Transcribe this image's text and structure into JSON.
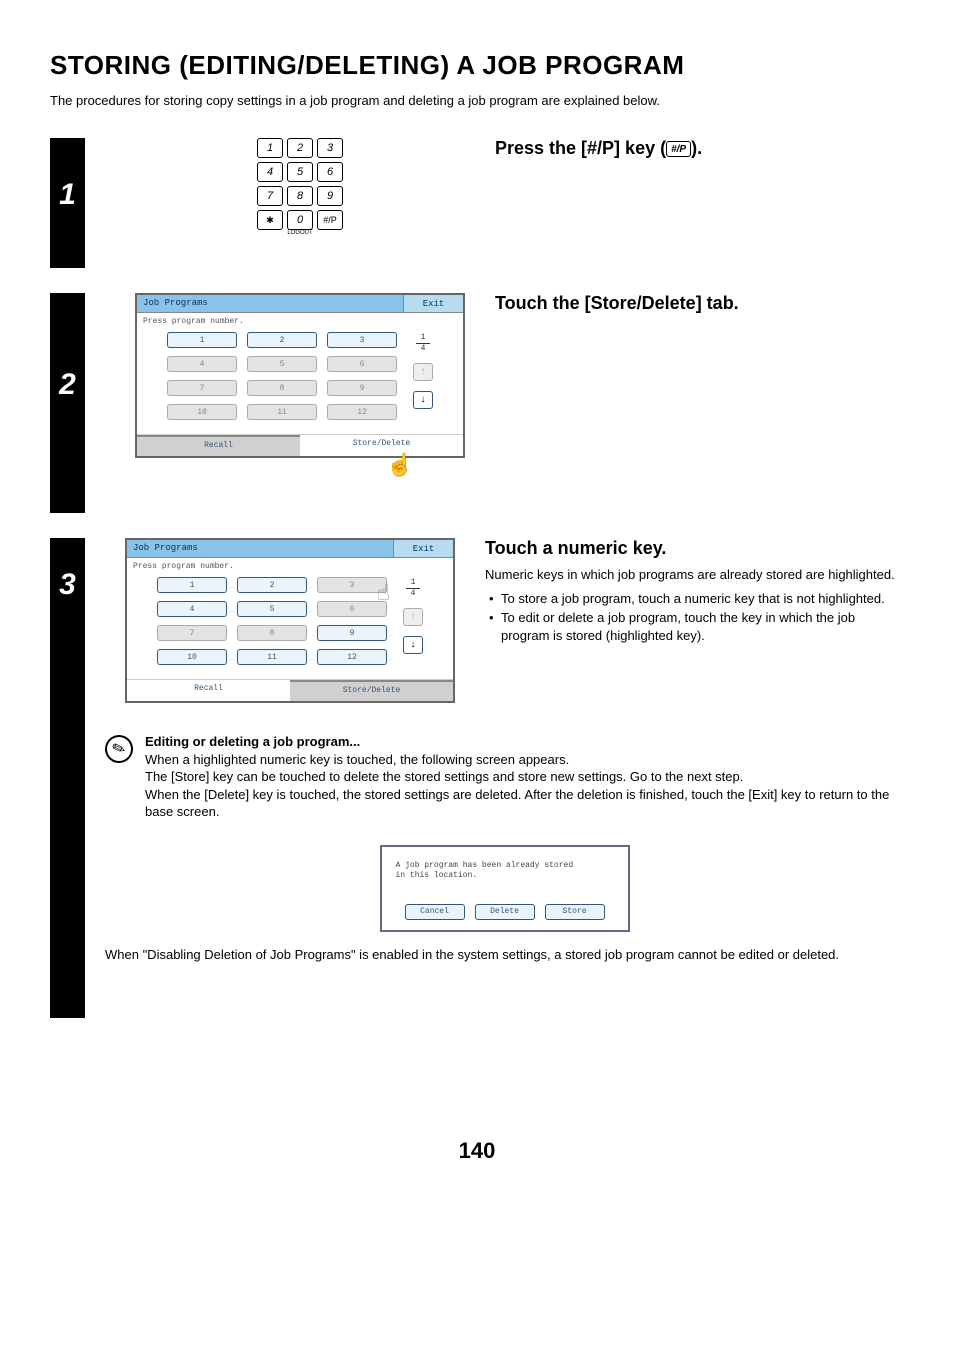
{
  "page_title": "STORING (EDITING/DELETING) A JOB PROGRAM",
  "intro": "The procedures for storing copy settings in a job program and deleting a job program are explained below.",
  "page_number": "140",
  "keypad": {
    "row1": [
      "1",
      "2",
      "3"
    ],
    "row2": [
      "4",
      "5",
      "6"
    ],
    "row3": [
      "7",
      "8",
      "9"
    ],
    "row4_star": "✱",
    "row4_zero": "0",
    "row4_hp": "#/P",
    "logout": "LOGOUT"
  },
  "step1": {
    "num": "1",
    "title_a": "Press the [#/P] key (",
    "title_b": ").",
    "hp_label": "#/P"
  },
  "step2": {
    "num": "2",
    "title": "Touch the [Store/Delete] tab.",
    "panel": {
      "title": "Job Programs",
      "exit": "Exit",
      "sub": "Press program number.",
      "keys": [
        "1",
        "2",
        "3",
        "4",
        "5",
        "6",
        "7",
        "8",
        "9",
        "10",
        "11",
        "12"
      ],
      "highlight": [
        0,
        1,
        2
      ],
      "page_top": "1",
      "page_bot": "4",
      "tab_recall": "Recall",
      "tab_store": "Store/Delete"
    }
  },
  "step3": {
    "num": "3",
    "title": "Touch a numeric key.",
    "desc": "Numeric keys in which job programs are already stored are highlighted.",
    "bullet1": "To store a job program, touch a numeric key that is not highlighted.",
    "bullet2": "To edit or delete a job program, touch the key in which the job program is stored (highlighted key).",
    "panel": {
      "title": "Job Programs",
      "exit": "Exit",
      "sub": "Press program number.",
      "keys": [
        "1",
        "2",
        "3",
        "4",
        "5",
        "6",
        "7",
        "8",
        "9",
        "10",
        "11",
        "12"
      ],
      "highlight": [
        0,
        1,
        3,
        4,
        8,
        9,
        10,
        11
      ],
      "page_top": "1",
      "page_bot": "4",
      "tab_recall": "Recall",
      "tab_store": "Store/Delete"
    },
    "note_heading": "Editing or deleting a job program...",
    "note_p1": "When a highlighted numeric key is touched, the following screen appears.",
    "note_p2": "The [Store] key can be touched to delete the stored settings and store new settings. Go to the next step.",
    "note_p3": "When the [Delete] key is touched, the stored settings are deleted. After the deletion is finished, touch the [Exit] key to return to the base screen.",
    "dialog_msg_l1": "A job program has been already stored",
    "dialog_msg_l2": "in this location.",
    "dialog_cancel": "Cancel",
    "dialog_delete": "Delete",
    "dialog_store": "Store",
    "footnote": "When \"Disabling Deletion of Job Programs\" is enabled in the system settings, a stored job program cannot be edited or deleted."
  }
}
